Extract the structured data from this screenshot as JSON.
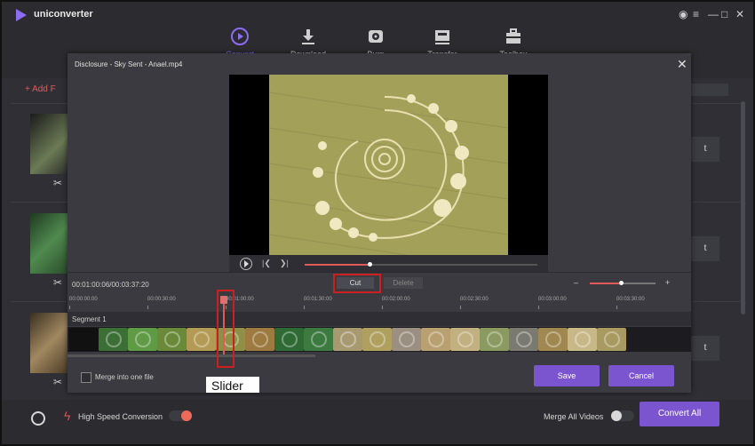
{
  "app": {
    "name": "uniconverter",
    "window_controls": [
      "◉",
      "≡",
      "—",
      "□",
      "✕"
    ]
  },
  "nav": {
    "items": [
      {
        "label": "Convert",
        "icon": "convert-icon",
        "active": true
      },
      {
        "label": "Download",
        "icon": "download-icon"
      },
      {
        "label": "Burn",
        "icon": "burn-icon"
      },
      {
        "label": "Transfer",
        "icon": "transfer-icon"
      },
      {
        "label": "Toolbox",
        "icon": "toolbox-icon"
      }
    ]
  },
  "list": {
    "add_files_label": "+ Add F",
    "row_button_label": "t",
    "scissors_glyph": "✂"
  },
  "modal": {
    "title": "Disclosure - Sky Sent - Anael.mp4",
    "close_glyph": "✕",
    "player": {
      "progress": 0.28,
      "prev_glyph": "|❮",
      "next_glyph": "❯|"
    },
    "editor": {
      "timecode": "00:01:00:06/00:03:37:20",
      "cut_label": "Cut",
      "delete_label": "Delete",
      "zoom_minus": "–",
      "zoom_plus": "+",
      "zoom_level": 0.47,
      "ruler_ticks": [
        "00:00:00:00",
        "00:00:30:00",
        "00:01:00:00",
        "00:01:30:00",
        "00:02:00:00",
        "00:02:30:00",
        "00:03:00:00",
        "00:03:30:00"
      ],
      "segment_label": "Segment 1"
    },
    "merge_label": "Merge into one file",
    "save_label": "Save",
    "cancel_label": "Cancel"
  },
  "bottom": {
    "high_speed_label": "High Speed Conversion",
    "high_speed_on": true,
    "merge_all_label": "Merge All Videos",
    "merge_all_on": false,
    "convert_all_label": "Convert All"
  },
  "annotation": {
    "slider_caption": "Slider"
  },
  "colors": {
    "accent": "#7b55d0",
    "highlight": "#e05a5a",
    "annotation": "#cc2020"
  }
}
